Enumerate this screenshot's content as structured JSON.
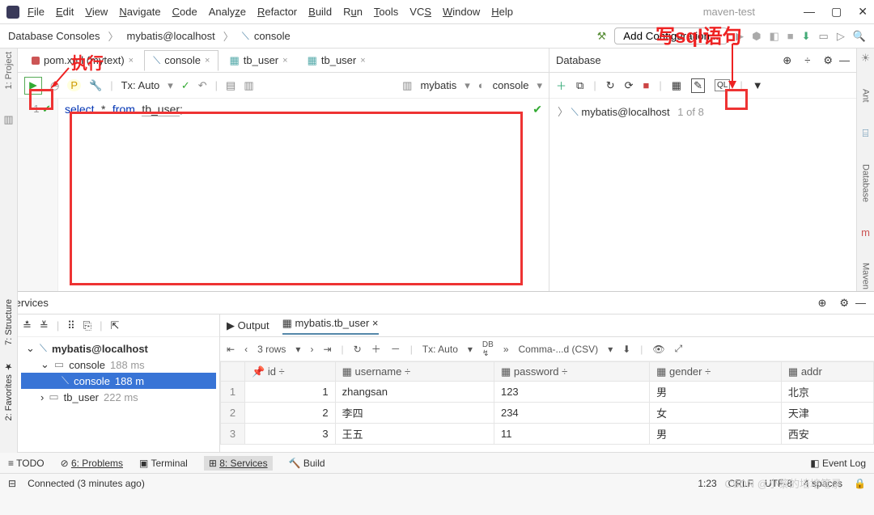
{
  "menu": [
    "File",
    "Edit",
    "View",
    "Navigate",
    "Code",
    "Analyze",
    "Refactor",
    "Build",
    "Run",
    "Tools",
    "VCS",
    "Window",
    "Help"
  ],
  "project": "maven-test",
  "breadcrumbs": [
    "Database Consoles",
    "mybatis@localhost",
    "console"
  ],
  "addConfig": "Add Configuration...",
  "tabs": [
    {
      "label": "pom.xml (mytext)",
      "active": false
    },
    {
      "label": "console",
      "active": true
    },
    {
      "label": "tb_user",
      "active": false
    },
    {
      "label": "tb_user",
      "active": false
    }
  ],
  "txAuto": "Tx: Auto",
  "dbSchema": "mybatis",
  "dbConsole": "console",
  "lineNum": "1",
  "sql": {
    "k1": "select",
    "star": "*",
    "k2": "from",
    "tbl": "tb_user",
    "semi": ";"
  },
  "dbPanel": {
    "title": "Database",
    "node": "mybatis@localhost",
    "count": "1 of 8"
  },
  "services": {
    "title": "Services",
    "tx": "Tx",
    "outputTab": "Output",
    "gridTab": "mybatis.tb_user",
    "tree": {
      "root": "mybatis@localhost",
      "consoleFolder": "console",
      "consoleFolderMs": "188 ms",
      "consoleItem": "console",
      "consoleItemMs": "188 m",
      "tbuser": "tb_user",
      "tbuserMs": "222 ms"
    },
    "rows": "3 rows",
    "txAuto": "Tx: Auto",
    "export": "Comma-...d (CSV)"
  },
  "columns": [
    "id",
    "username",
    "password",
    "gender",
    "addr"
  ],
  "data": [
    {
      "id": "1",
      "username": "zhangsan",
      "password": "123",
      "gender": "男",
      "addr": "北京"
    },
    {
      "id": "2",
      "username": "李四",
      "password": "234",
      "gender": "女",
      "addr": "天津"
    },
    {
      "id": "3",
      "username": "王五",
      "password": "11",
      "gender": "男",
      "addr": "西安"
    }
  ],
  "bottomTabs": {
    "todo": "TODO",
    "problems": "6: Problems",
    "terminal": "Terminal",
    "services": "8: Services",
    "build": "Build",
    "eventlog": "Event Log"
  },
  "status": {
    "msg": "Connected (3 minutes ago)",
    "pos": "1:23",
    "eol": "CRLF",
    "enc": "UTF-8",
    "indent": "4 spaces"
  },
  "annot": {
    "exec": "执行",
    "sql": "写sql语句"
  },
  "watermark": "CSDN @小黎的培培笔录"
}
